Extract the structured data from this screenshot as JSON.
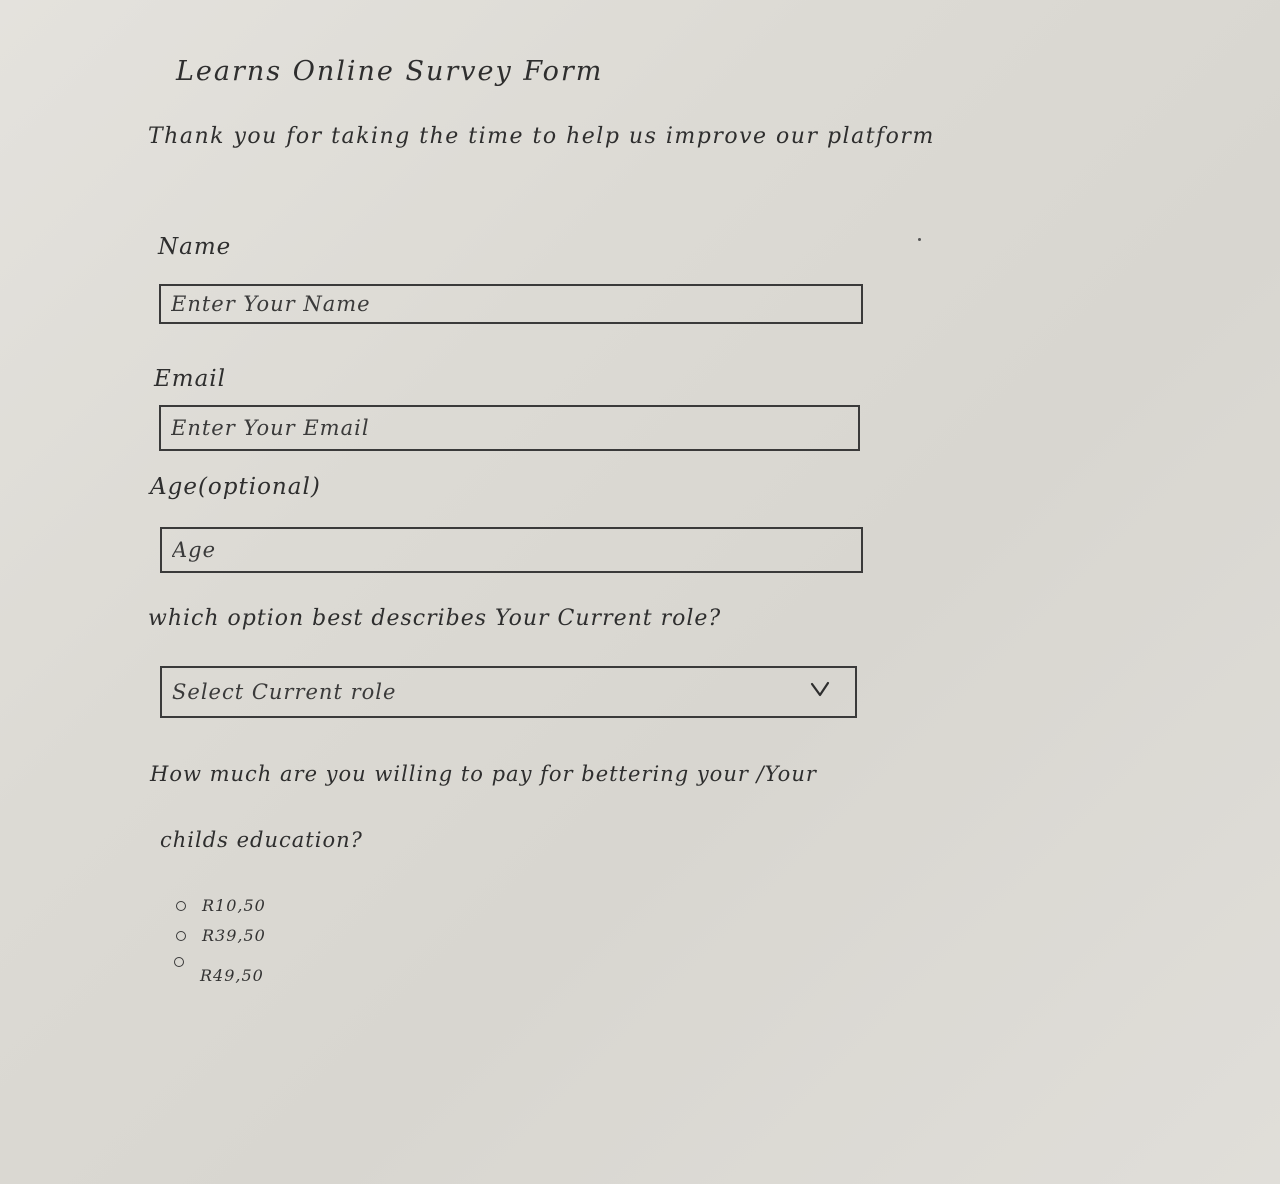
{
  "form": {
    "title": "Learns Online Survey Form",
    "subtitle": "Thank you for taking the time to help us improve our platform"
  },
  "fields": {
    "name": {
      "label": "Name",
      "placeholder": "Enter Your Name"
    },
    "email": {
      "label": "Email",
      "placeholder": "Enter Your Email"
    },
    "age": {
      "label": "Age(optional)",
      "placeholder": "Age"
    }
  },
  "role": {
    "question": "which option best describes Your Current role?",
    "selected": "Select Current role",
    "icon": "chevron-down-icon"
  },
  "payment": {
    "question_line1": "How much are you willing to pay for bettering your /Your",
    "question_line2": "childs education?",
    "options": [
      "R10,50",
      "R39,50",
      "R49,50"
    ]
  }
}
